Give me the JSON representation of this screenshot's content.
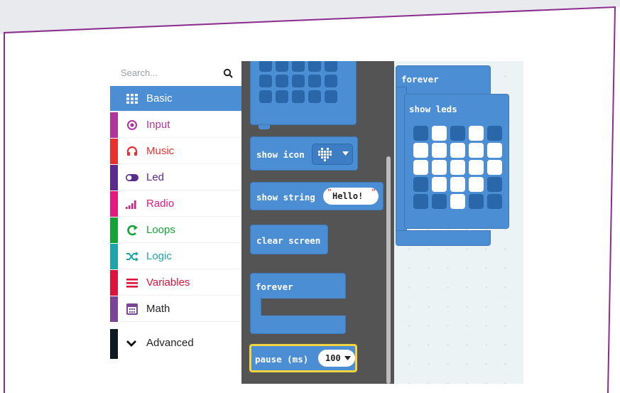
{
  "toolbox": {
    "search_placeholder": "Search...",
    "categories": [
      {
        "label": "Basic",
        "icon": "grid-icon",
        "color": "#ffffff",
        "bg": "#4c8ed3",
        "stripe": "#4c8ed3"
      },
      {
        "label": "Input",
        "icon": "target-icon",
        "color": "#b0359b",
        "stripe": "#b0359b"
      },
      {
        "label": "Music",
        "icon": "headphones-icon",
        "color": "#e8322e",
        "stripe": "#e8322e"
      },
      {
        "label": "Led",
        "icon": "toggle-icon",
        "color": "#5b2a8f",
        "stripe": "#5b2a8f"
      },
      {
        "label": "Radio",
        "icon": "signal-icon",
        "color": "#e5197e",
        "stripe": "#e5197e"
      },
      {
        "label": "Loops",
        "icon": "loop-icon",
        "color": "#15a338",
        "stripe": "#15a338"
      },
      {
        "label": "Logic",
        "icon": "shuffle-icon",
        "color": "#1fa4aa",
        "stripe": "#1fa4aa"
      },
      {
        "label": "Variables",
        "icon": "list-icon",
        "color": "#dc143c",
        "stripe": "#dc143c"
      },
      {
        "label": "Math",
        "icon": "calculator-icon",
        "color": "#7a4597",
        "stripe": "#7a4597"
      }
    ],
    "advanced_label": "Advanced"
  },
  "flyout": {
    "show_icon": "show icon",
    "show_string": "show string",
    "string_value": "Hello!",
    "clear_screen": "clear screen",
    "forever": "forever",
    "pause": "pause (ms)",
    "pause_value": "100"
  },
  "workspace": {
    "forever": "forever",
    "show_leds": "show leds",
    "leds": [
      [
        0,
        1,
        0,
        1,
        0
      ],
      [
        1,
        1,
        1,
        1,
        1
      ],
      [
        1,
        1,
        1,
        1,
        1
      ],
      [
        0,
        1,
        1,
        1,
        0
      ],
      [
        0,
        0,
        1,
        0,
        0
      ]
    ]
  }
}
